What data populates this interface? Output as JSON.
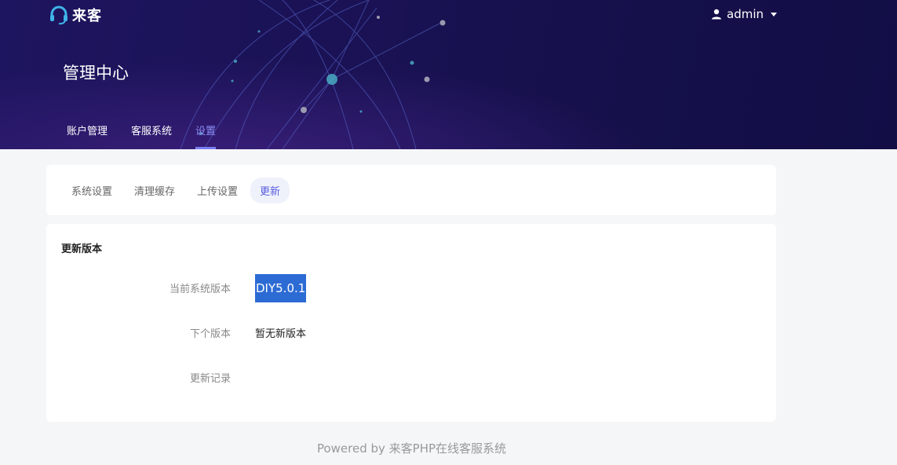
{
  "brand": {
    "name": "来客"
  },
  "user": {
    "name": "admin"
  },
  "header": {
    "title": "管理中心"
  },
  "top_nav": [
    {
      "label": "账户管理"
    },
    {
      "label": "客服系统"
    },
    {
      "label": "设置"
    }
  ],
  "tabs": [
    {
      "label": "系统设置"
    },
    {
      "label": "清理缓存"
    },
    {
      "label": "上传设置"
    },
    {
      "label": "更新"
    }
  ],
  "update": {
    "title": "更新版本",
    "current_label": "当前系统版本",
    "current_value": "DIY5.0.1",
    "next_label": "下个版本",
    "next_value": "暂无新版本",
    "log_label": "更新记录",
    "log_value": ""
  },
  "footer": {
    "text": "Powered by 来客PHP在线客服系统"
  },
  "colors": {
    "accent": "#7b7cf2",
    "header_bg": "#1a1254",
    "highlight": "#2d6bd4"
  }
}
